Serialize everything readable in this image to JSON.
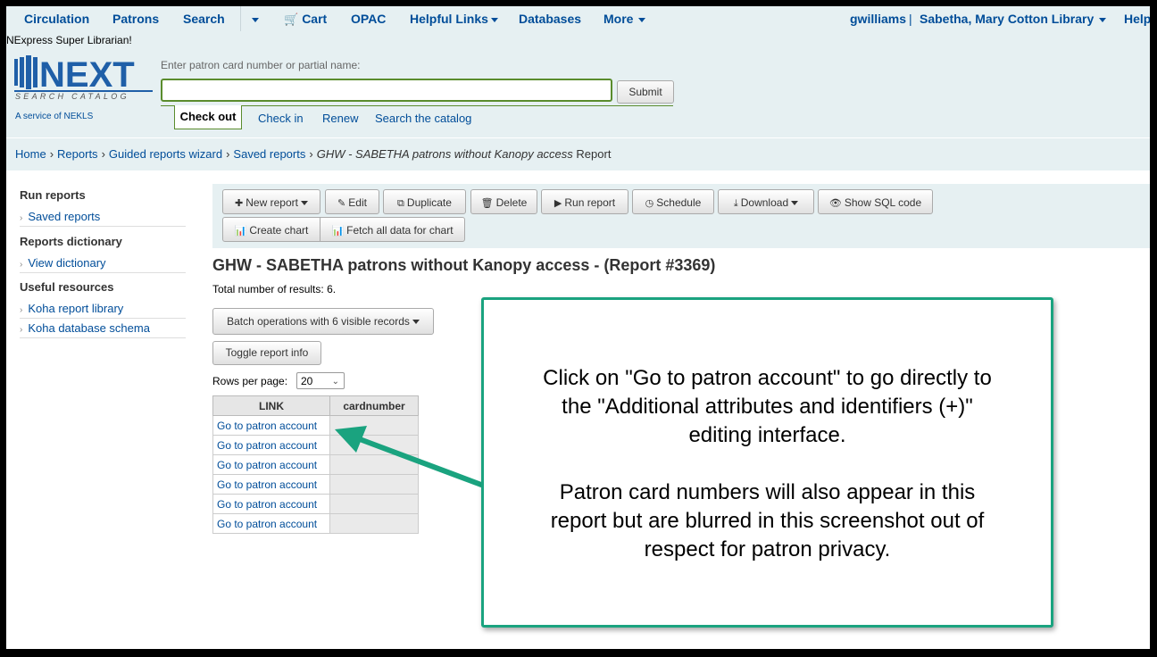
{
  "nav": {
    "circulation": "Circulation",
    "patrons": "Patrons",
    "search": "Search",
    "cart": "Cart",
    "opac": "OPAC",
    "helpful_links": "Helpful Links",
    "databases": "Databases",
    "more": "More",
    "user": "gwilliams",
    "separator": "|",
    "library": "Sabetha, Mary Cotton Library",
    "help": "Help"
  },
  "header": {
    "logged_in_as": "NExpress Super Librarian!",
    "logo_word": "NEXT",
    "logo_sub": "SEARCH CATALOG",
    "logo_service": "A service of NEKLS",
    "search_label": "Enter patron card number or partial name:",
    "search_value": "",
    "submit_label": "Submit",
    "tabs": [
      "Check out",
      "Check in",
      "Renew",
      "Search the catalog"
    ]
  },
  "breadcrumb": {
    "home": "Home",
    "reports": "Reports",
    "wizard": "Guided reports wizard",
    "saved": "Saved reports",
    "current_italic": "GHW - SABETHA patrons without Kanopy access",
    "current_suffix": "Report",
    "sep": "›"
  },
  "sidebar": {
    "run_reports": "Run reports",
    "saved_reports": "Saved reports",
    "reports_dictionary": "Reports dictionary",
    "view_dictionary": "View dictionary",
    "useful_resources": "Useful resources",
    "koha_report_library": "Koha report library",
    "koha_db_schema": "Koha database schema"
  },
  "toolbar": {
    "new_report": "New report",
    "edit": "Edit",
    "duplicate": "Duplicate",
    "delete": "Delete",
    "run_report": "Run report",
    "schedule": "Schedule",
    "download": "Download",
    "show_sql": "Show SQL code",
    "create_chart": "Create chart",
    "fetch_data": "Fetch all data for chart"
  },
  "report": {
    "title": "GHW - SABETHA patrons without Kanopy access - (Report #3369)",
    "total_label": "Total number of results:",
    "total_value": "6.",
    "batch_label": "Batch operations with 6 visible records",
    "toggle_label": "Toggle report info",
    "rows_label": "Rows per page:",
    "rows_value": "20",
    "columns": [
      "LINK",
      "cardnumber"
    ],
    "rows": [
      "Go to patron account",
      "Go to patron account",
      "Go to patron account",
      "Go to patron account",
      "Go to patron account",
      "Go to patron account"
    ]
  },
  "callout": {
    "line1": "Click on \"Go to patron account\" to go directly to",
    "line2": "the \"Additional attributes and identifiers (+)\"",
    "line3": "editing interface.",
    "line4": "Patron card numbers will also appear in this",
    "line5": "report but are blurred in this screenshot out of",
    "line6": "respect for patron privacy."
  },
  "colors": {
    "link": "#004d99",
    "header_bg": "#e6f0f2",
    "callout_border": "#1aa37f",
    "search_border": "#5a8c2d"
  }
}
